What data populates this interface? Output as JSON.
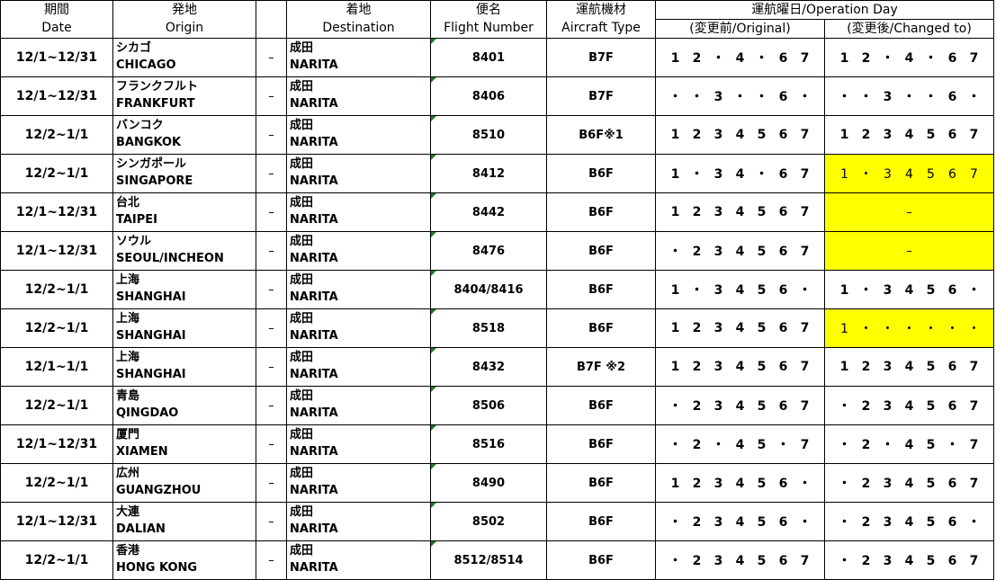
{
  "header": {
    "date_jp": "期間",
    "date_en": "Date",
    "origin_jp": "発地",
    "origin_en": "Origin",
    "dest_jp": "着地",
    "dest_en": "Destination",
    "flight_jp": "便名",
    "flight_en": "Flight Number",
    "aircraft_jp": "運航機材",
    "aircraft_en": "Aircraft Type",
    "opday": "運航曜日/Operation Day",
    "original": "(変更前/Original)",
    "changed": "(変更後/Changed to)"
  },
  "highlight_color": "#ffff00",
  "rows": [
    {
      "date": "12/1~12/31",
      "origin_jp": "シカゴ",
      "origin_en": "CHICAGO",
      "sep": "–",
      "dest_jp": "成田",
      "dest_en": "NARITA",
      "flight": "8401",
      "aircraft": "B7F",
      "original": [
        "1",
        "2",
        "・",
        "4",
        "・",
        "6",
        "7"
      ],
      "changed": [
        "1",
        "2",
        "・",
        "4",
        "・",
        "6",
        "7"
      ],
      "changed_highlight": false,
      "changed_dash": ""
    },
    {
      "date": "12/1~12/31",
      "origin_jp": "フランクフルト",
      "origin_en": "FRANKFURT",
      "sep": "–",
      "dest_jp": "成田",
      "dest_en": "NARITA",
      "flight": "8406",
      "aircraft": "B7F",
      "original": [
        "・",
        "・",
        "3",
        "・",
        "・",
        "6",
        "・"
      ],
      "changed": [
        "・",
        "・",
        "3",
        "・",
        "・",
        "6",
        "・"
      ],
      "changed_highlight": false,
      "changed_dash": ""
    },
    {
      "date": "12/2~1/1",
      "origin_jp": "バンコク",
      "origin_en": "BANGKOK",
      "sep": "–",
      "dest_jp": "成田",
      "dest_en": "NARITA",
      "flight": "8510",
      "aircraft": "B6F※1",
      "original": [
        "1",
        "2",
        "3",
        "4",
        "5",
        "6",
        "7"
      ],
      "changed": [
        "1",
        "2",
        "3",
        "4",
        "5",
        "6",
        "7"
      ],
      "changed_highlight": false,
      "changed_dash": ""
    },
    {
      "date": "12/2~1/1",
      "origin_jp": "シンガポール",
      "origin_en": "SINGAPORE",
      "sep": "–",
      "dest_jp": "成田",
      "dest_en": "NARITA",
      "flight": "8412",
      "aircraft": "B6F",
      "original": [
        "1",
        "・",
        "3",
        "4",
        "・",
        "6",
        "7"
      ],
      "changed": [
        "1",
        "・",
        "3",
        "4",
        "5",
        "6",
        "7"
      ],
      "changed_highlight": true,
      "changed_dash": ""
    },
    {
      "date": "12/1~12/31",
      "origin_jp": "台北",
      "origin_en": "TAIPEI",
      "sep": "–",
      "dest_jp": "成田",
      "dest_en": "NARITA",
      "flight": "8442",
      "aircraft": "B6F",
      "original": [
        "1",
        "2",
        "3",
        "4",
        "5",
        "6",
        "7"
      ],
      "changed": [],
      "changed_highlight": true,
      "changed_dash": "–"
    },
    {
      "date": "12/1~12/31",
      "origin_jp": "ソウル",
      "origin_en": "SEOUL/INCHEON",
      "sep": "–",
      "dest_jp": "成田",
      "dest_en": "NARITA",
      "flight": "8476",
      "aircraft": "B6F",
      "original": [
        "・",
        "2",
        "3",
        "4",
        "5",
        "6",
        "7"
      ],
      "changed": [],
      "changed_highlight": true,
      "changed_dash": "–"
    },
    {
      "date": "12/2~1/1",
      "origin_jp": "上海",
      "origin_en": "SHANGHAI",
      "sep": "–",
      "dest_jp": "成田",
      "dest_en": "NARITA",
      "flight": "8404/8416",
      "aircraft": "B6F",
      "original": [
        "1",
        "・",
        "3",
        "4",
        "5",
        "6",
        "・"
      ],
      "changed": [
        "1",
        "・",
        "3",
        "4",
        "5",
        "6",
        "・"
      ],
      "changed_highlight": false,
      "changed_dash": ""
    },
    {
      "date": "12/2~1/1",
      "origin_jp": "上海",
      "origin_en": "SHANGHAI",
      "sep": "–",
      "dest_jp": "成田",
      "dest_en": "NARITA",
      "flight": "8518",
      "aircraft": "B6F",
      "original": [
        "1",
        "2",
        "3",
        "4",
        "5",
        "6",
        "7"
      ],
      "changed": [
        "1",
        "・",
        "・",
        "・",
        "・",
        "・",
        "・"
      ],
      "changed_highlight": true,
      "changed_dash": ""
    },
    {
      "date": "12/1~1/1",
      "origin_jp": "上海",
      "origin_en": "SHANGHAI",
      "sep": "–",
      "dest_jp": "成田",
      "dest_en": "NARITA",
      "flight": "8432",
      "aircraft": "B7F ※2",
      "original": [
        "1",
        "2",
        "3",
        "4",
        "5",
        "6",
        "7"
      ],
      "changed": [
        "1",
        "2",
        "3",
        "4",
        "5",
        "6",
        "7"
      ],
      "changed_highlight": false,
      "changed_dash": ""
    },
    {
      "date": "12/2~1/1",
      "origin_jp": "青島",
      "origin_en": "QINGDAO",
      "sep": "–",
      "dest_jp": "成田",
      "dest_en": "NARITA",
      "flight": "8506",
      "aircraft": "B6F",
      "original": [
        "・",
        "2",
        "3",
        "4",
        "5",
        "6",
        "7"
      ],
      "changed": [
        "・",
        "2",
        "3",
        "4",
        "5",
        "6",
        "7"
      ],
      "changed_highlight": false,
      "changed_dash": ""
    },
    {
      "date": "12/1~12/31",
      "origin_jp": "厦門",
      "origin_en": "XIAMEN",
      "sep": "–",
      "dest_jp": "成田",
      "dest_en": "NARITA",
      "flight": "8516",
      "aircraft": "B6F",
      "original": [
        "・",
        "2",
        "・",
        "4",
        "5",
        "・",
        "7"
      ],
      "changed": [
        "・",
        "2",
        "・",
        "4",
        "5",
        "・",
        "7"
      ],
      "changed_highlight": false,
      "changed_dash": ""
    },
    {
      "date": "12/2~1/1",
      "origin_jp": "広州",
      "origin_en": "GUANGZHOU",
      "sep": "–",
      "dest_jp": "成田",
      "dest_en": "NARITA",
      "flight": "8490",
      "aircraft": "B6F",
      "original": [
        "1",
        "2",
        "3",
        "4",
        "5",
        "6",
        "・"
      ],
      "changed": [
        "・",
        "2",
        "3",
        "4",
        "5",
        "6",
        "7"
      ],
      "changed_highlight": false,
      "changed_dash": ""
    },
    {
      "date": "12/1~12/31",
      "origin_jp": "大連",
      "origin_en": "DALIAN",
      "sep": "–",
      "dest_jp": "成田",
      "dest_en": "NARITA",
      "flight": "8502",
      "aircraft": "B6F",
      "original": [
        "・",
        "2",
        "3",
        "4",
        "5",
        "6",
        "・"
      ],
      "changed": [
        "・",
        "2",
        "3",
        "4",
        "5",
        "6",
        "・"
      ],
      "changed_highlight": false,
      "changed_dash": ""
    },
    {
      "date": "12/2~1/1",
      "origin_jp": "香港",
      "origin_en": "HONG KONG",
      "sep": "–",
      "dest_jp": "成田",
      "dest_en": "NARITA",
      "flight": "8512/8514",
      "aircraft": "B6F",
      "original": [
        "・",
        "2",
        "3",
        "4",
        "5",
        "6",
        "7"
      ],
      "changed": [
        "・",
        "2",
        "3",
        "4",
        "5",
        "6",
        "7"
      ],
      "changed_highlight": false,
      "changed_dash": ""
    }
  ]
}
